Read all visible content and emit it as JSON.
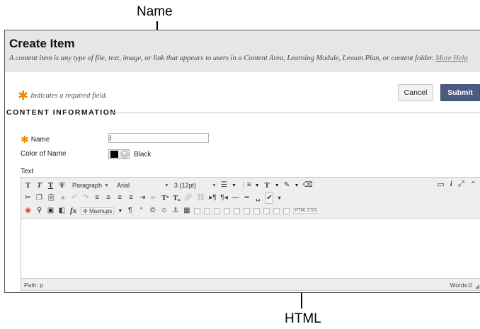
{
  "callouts": {
    "top": "Name",
    "bottom": "HTML"
  },
  "header": {
    "title": "Create Item",
    "description": "A content item is any type of file, text, image, or link that appears to users in a Content Area, Learning Module, Lesson Plan, or content folder.",
    "help_link": "More Help"
  },
  "required_note": "Indicates a required field.",
  "buttons": {
    "cancel": "Cancel",
    "submit": "Submit"
  },
  "section": {
    "title": "CONTENT INFORMATION"
  },
  "form": {
    "name_label": "Name",
    "name_value": "",
    "color_label": "Color of Name",
    "color_value": "Black",
    "color_hex": "#000000",
    "text_label": "Text"
  },
  "editor": {
    "format_select": "Paragraph",
    "font_select": "Arial",
    "size_select": "3 (12pt)",
    "mashups_label": "Mashups",
    "html_label": "HTML",
    "css_label": "CSS",
    "path_label": "Path: p",
    "words_label": "Words:0"
  },
  "colors": {
    "accent_star": "#f08c00",
    "submit_bg": "#4a5a80",
    "header_bg": "#e6e6e6"
  }
}
